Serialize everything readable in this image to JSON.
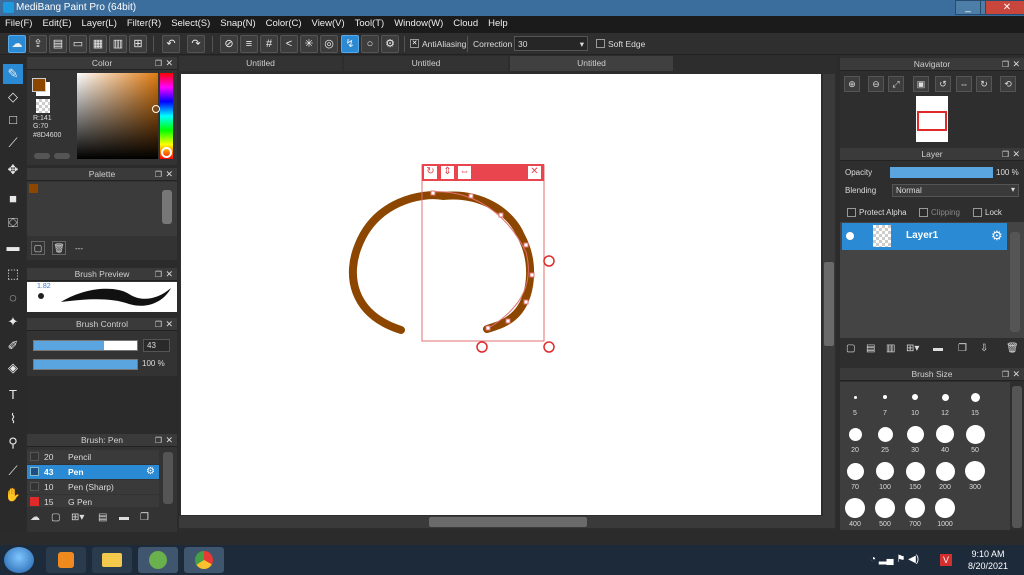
{
  "window": {
    "title": "MediBang Paint Pro (64bit)"
  },
  "menu": [
    "File(F)",
    "Edit(E)",
    "Layer(L)",
    "Filter(R)",
    "Select(S)",
    "Snap(N)",
    "Color(C)",
    "View(V)",
    "Tool(T)",
    "Window(W)",
    "Cloud",
    "Help"
  ],
  "toolbar": {
    "antialiasing_label": "AntiAliasing",
    "correction_label": "Correction",
    "correction_value": "30",
    "soft_edge_label": "Soft Edge"
  },
  "color_panel": {
    "title": "Color",
    "r": "R:141",
    "g": "G:70",
    "hex": "#8D4600",
    "colors": {
      "primary": "#8D4600",
      "secondary": "#FFFFFF"
    }
  },
  "palette_panel": {
    "title": "Palette",
    "name": "---"
  },
  "brush_preview": {
    "title": "Brush Preview",
    "size_label": "1.82"
  },
  "brush_control": {
    "title": "Brush Control",
    "size_value": "43",
    "opacity_value": "100 %",
    "size_fraction": 0.43,
    "opacity_fraction": 1.0
  },
  "brush_list": {
    "title": "Brush: Pen",
    "items": [
      {
        "size": "20",
        "name": "Pencil",
        "color": "#333333"
      },
      {
        "size": "43",
        "name": "Pen",
        "color": "#2a8ad4",
        "selected": true
      },
      {
        "size": "10",
        "name": "Pen (Sharp)",
        "color": "#333333"
      },
      {
        "size": "15",
        "name": "G Pen",
        "color": "#e02a2a"
      }
    ]
  },
  "documents": {
    "tabs": [
      "Untitled",
      "Untitled",
      "Untitled"
    ],
    "active": 2
  },
  "navigator": {
    "title": "Navigator"
  },
  "layer_panel": {
    "title": "Layer",
    "opacity_label": "Opacity",
    "opacity_value": "100 %",
    "blending_label": "Blending",
    "blending_value": "Normal",
    "protect_alpha": "Protect Alpha",
    "clipping": "Clipping",
    "lock": "Lock",
    "layer_name": "Layer1"
  },
  "brush_size": {
    "title": "Brush Size",
    "sizes": [
      "5",
      "7",
      "10",
      "12",
      "15",
      "20",
      "25",
      "30",
      "40",
      "50",
      "70",
      "100",
      "150",
      "200",
      "300",
      "400",
      "500",
      "700",
      "1000"
    ]
  },
  "taskbar": {
    "time": "9:10 AM",
    "date": "8/20/2021"
  }
}
